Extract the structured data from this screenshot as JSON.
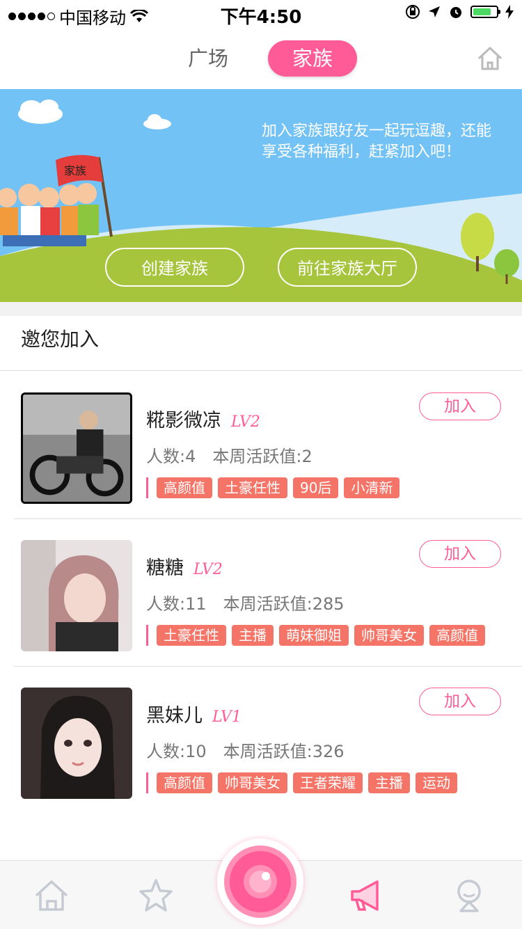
{
  "status_bar": {
    "carrier": "中国移动",
    "time": "下午4:50"
  },
  "nav": {
    "tab_square": "广场",
    "tab_family": "家族"
  },
  "banner": {
    "text": "加入家族跟好友一起玩逗趣，还能享受各种福利，赶紧加入吧！",
    "flag_text": "家族",
    "create_button": "创建家族",
    "hall_button": "前往家族大厅"
  },
  "section": {
    "title": "邀您加入"
  },
  "families": [
    {
      "name": "糀影微凉",
      "level": "LV2",
      "members": "人数:4",
      "activity": "本周活跃值:2",
      "tags": [
        "高颜值",
        "土豪任性",
        "90后",
        "小清新"
      ],
      "join": "加入"
    },
    {
      "name": "糖糖",
      "level": "LV2",
      "members": "人数:11",
      "activity": "本周活跃值:285",
      "tags": [
        "土豪任性",
        "主播",
        "萌妹御姐",
        "帅哥美女",
        "高颜值"
      ],
      "join": "加入"
    },
    {
      "name": "黑妹儿",
      "level": "LV1",
      "members": "人数:10",
      "activity": "本周活跃值:326",
      "tags": [
        "高颜值",
        "帅哥美女",
        "王者荣耀",
        "主播",
        "运动"
      ],
      "join": "加入"
    }
  ],
  "colors": {
    "accent": "#ff5c97",
    "tag": "#f47567",
    "banner_sky": "#72c2f5",
    "banner_grass": "#a6c43c"
  }
}
